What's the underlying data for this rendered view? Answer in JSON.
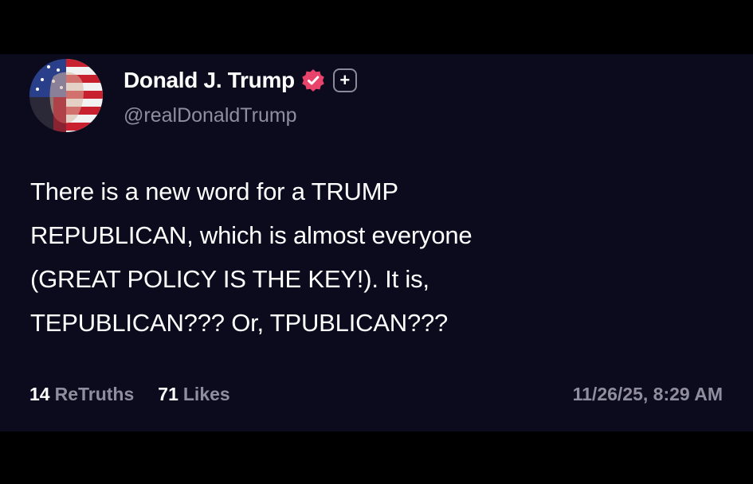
{
  "post": {
    "author": {
      "display_name": "Donald J. Trump",
      "handle": "@realDonaldTrump",
      "avatar_icon": "avatar-image",
      "verified_icon": "verified-badge-icon",
      "plus_icon": "plus-badge-icon",
      "plus_glyph": "+"
    },
    "text_lines": [
      "There is a new word for a TRUMP",
      "REPUBLICAN, which is almost everyone",
      "(GREAT POLICY IS THE KEY!). It is,",
      "TEPUBLICAN??? Or, TPUBLICAN???"
    ],
    "stats": {
      "retruths_count": "14",
      "retruths_label": "ReTruths",
      "likes_count": "71",
      "likes_label": "Likes"
    },
    "timestamp": "11/26/25, 8:29 AM"
  },
  "colors": {
    "page_background": "#000000",
    "card_background": "#0c0a1d",
    "primary_text": "#ffffff",
    "secondary_text": "#8f8d9e",
    "verified_badge": "#e8436b"
  }
}
